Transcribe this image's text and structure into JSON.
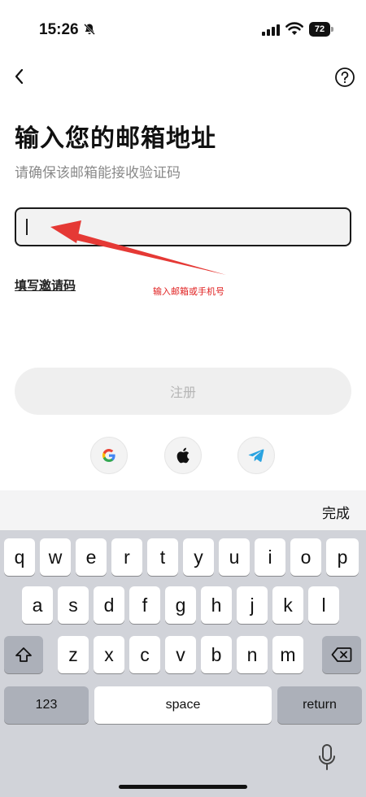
{
  "status_bar": {
    "time": "15:26",
    "battery": "72"
  },
  "header": {
    "title": "输入您的邮箱地址",
    "subtitle": "请确保该邮箱能接收验证码"
  },
  "email_input": {
    "value": "",
    "placeholder": ""
  },
  "annotation": {
    "text": "输入邮箱或手机号",
    "color": "#e02020"
  },
  "invite_link": "填写邀请码",
  "register_button": "注册",
  "social_logins": [
    "google-icon",
    "apple-icon",
    "telegram-icon"
  ],
  "keyboard": {
    "done": "完成",
    "row1": [
      "q",
      "w",
      "e",
      "r",
      "t",
      "y",
      "u",
      "i",
      "o",
      "p"
    ],
    "row2": [
      "a",
      "s",
      "d",
      "f",
      "g",
      "h",
      "j",
      "k",
      "l"
    ],
    "row3": [
      "z",
      "x",
      "c",
      "v",
      "b",
      "n",
      "m"
    ],
    "numbers": "123",
    "space": "space",
    "return": "return"
  }
}
